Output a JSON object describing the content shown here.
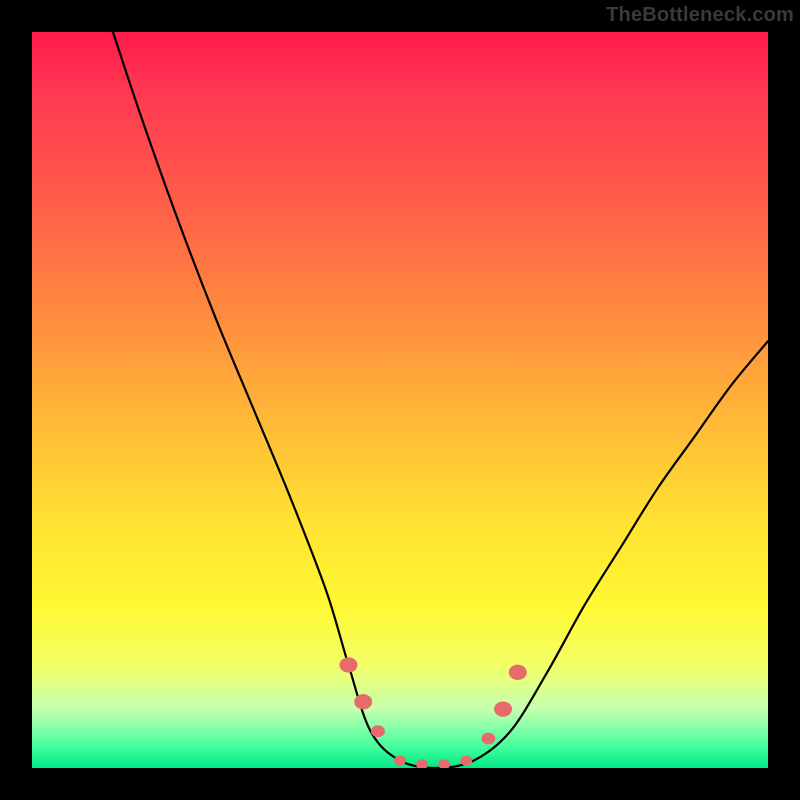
{
  "watermark": "TheBottleneck.com",
  "chart_data": {
    "type": "line",
    "title": "",
    "xlabel": "",
    "ylabel": "",
    "xlim": [
      0,
      100
    ],
    "ylim": [
      0,
      100
    ],
    "grid": false,
    "series": [
      {
        "name": "bottleneck-curve",
        "x": [
          11,
          15,
          20,
          25,
          30,
          35,
          40,
          43,
          46,
          50,
          55,
          60,
          65,
          70,
          75,
          80,
          85,
          90,
          95,
          100
        ],
        "y": [
          100,
          88,
          74,
          61,
          49,
          37,
          24,
          14,
          5,
          1,
          0,
          1,
          5,
          13,
          22,
          30,
          38,
          45,
          52,
          58
        ]
      }
    ],
    "markers": {
      "name": "highlighted-points",
      "color": "#e76b6b",
      "points": [
        {
          "x": 43,
          "y": 14
        },
        {
          "x": 45,
          "y": 9
        },
        {
          "x": 47,
          "y": 5
        },
        {
          "x": 50,
          "y": 1
        },
        {
          "x": 53,
          "y": 0.5
        },
        {
          "x": 56,
          "y": 0.5
        },
        {
          "x": 59,
          "y": 1
        },
        {
          "x": 62,
          "y": 4
        },
        {
          "x": 64,
          "y": 8
        },
        {
          "x": 66,
          "y": 13
        }
      ]
    },
    "background_gradient": {
      "top": "#ff1a4d",
      "mid": "#fff933",
      "bottom": "#00e884"
    }
  }
}
